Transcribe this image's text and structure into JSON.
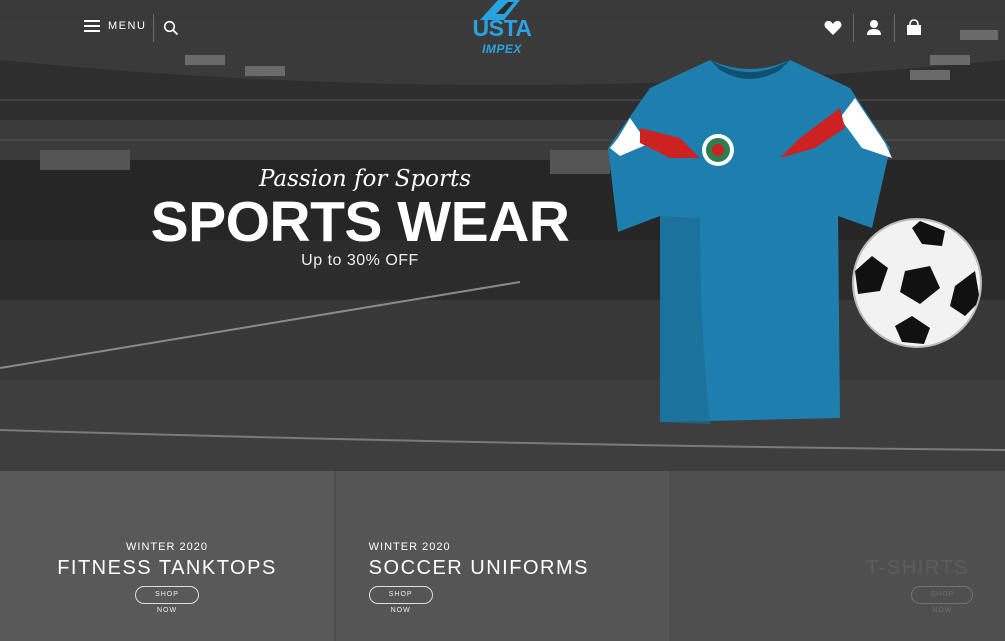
{
  "header": {
    "menu_label": "MENU",
    "logo_top": "USTA",
    "logo_bottom": "IMPEX",
    "icons": [
      "hamburger-icon",
      "search-icon",
      "heart-icon",
      "user-icon",
      "cart-icon"
    ]
  },
  "hero": {
    "tagline": "Passion for Sports",
    "headline": "SPORTS WEAR",
    "subline": "Up to 30% OFF",
    "colors": {
      "jersey": "#1e7fae",
      "logo_blue": "#29a3e0",
      "accent_red": "#cc2222"
    }
  },
  "categories": [
    {
      "season": "WINTER 2020",
      "title": "FITNESS TANKTOPS",
      "button": "SHOP NOW"
    },
    {
      "season": "WINTER 2020",
      "title": "SOCCER UNIFORMS",
      "button": "SHOP NOW"
    },
    {
      "season": "",
      "title": "T-SHIRTS",
      "button": "SHOP NOW"
    }
  ]
}
